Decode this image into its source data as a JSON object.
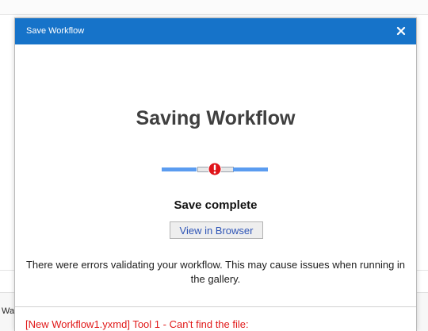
{
  "background": {
    "partial_text": "Wa"
  },
  "dialog": {
    "title": "Save Workflow",
    "close_icon": "close-icon",
    "heading": "Saving Workflow",
    "progress": {
      "state": "error",
      "error_icon": "error-exclamation-icon",
      "colors": {
        "bar": "#5b9cf0",
        "error": "#e0141a"
      }
    },
    "status": "Save complete",
    "view_button": "View in Browser",
    "message": "There were errors validating your workflow. This may cause issues when running in the gallery.",
    "errors": [
      "[New Workflow1.yxmd] Tool 1 - Can't find the file:"
    ],
    "colors": {
      "titlebar": "#1673c9",
      "error_text": "#e11a1a",
      "button_text": "#2f55b6"
    }
  }
}
